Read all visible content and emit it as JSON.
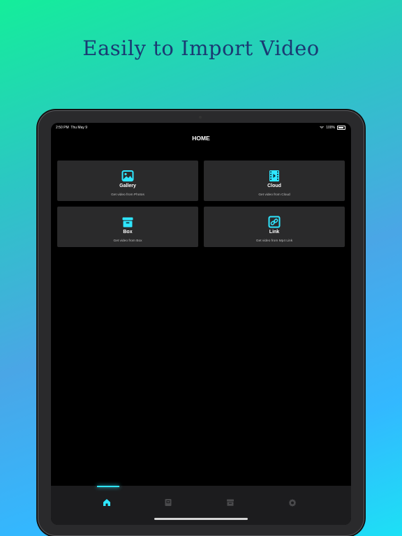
{
  "promo": {
    "headline": "Easily to Import Video"
  },
  "status_bar": {
    "time": "2:50 PM",
    "date": "Thu May 9",
    "battery": "100%"
  },
  "nav": {
    "title": "HOME"
  },
  "cards": [
    {
      "title": "Gallery",
      "subtitle": "Get video from Photos",
      "icon": "gallery-icon"
    },
    {
      "title": "Cloud",
      "subtitle": "Get video from Cloud",
      "icon": "film-icon"
    },
    {
      "title": "Box",
      "subtitle": "Get video from Box",
      "icon": "box-icon"
    },
    {
      "title": "Link",
      "subtitle": "Get video from Mp4 Link",
      "icon": "link-icon"
    }
  ],
  "tabbar": {
    "active_index": 0,
    "tabs": [
      {
        "icon": "home-icon"
      },
      {
        "icon": "files-icon"
      },
      {
        "icon": "archive-icon"
      },
      {
        "icon": "settings-icon"
      }
    ]
  },
  "colors": {
    "accent": "#2fe6ff",
    "card_bg": "#2a2a2b",
    "tab_inactive": "#4a4a4c",
    "headline": "#1a3a73"
  }
}
